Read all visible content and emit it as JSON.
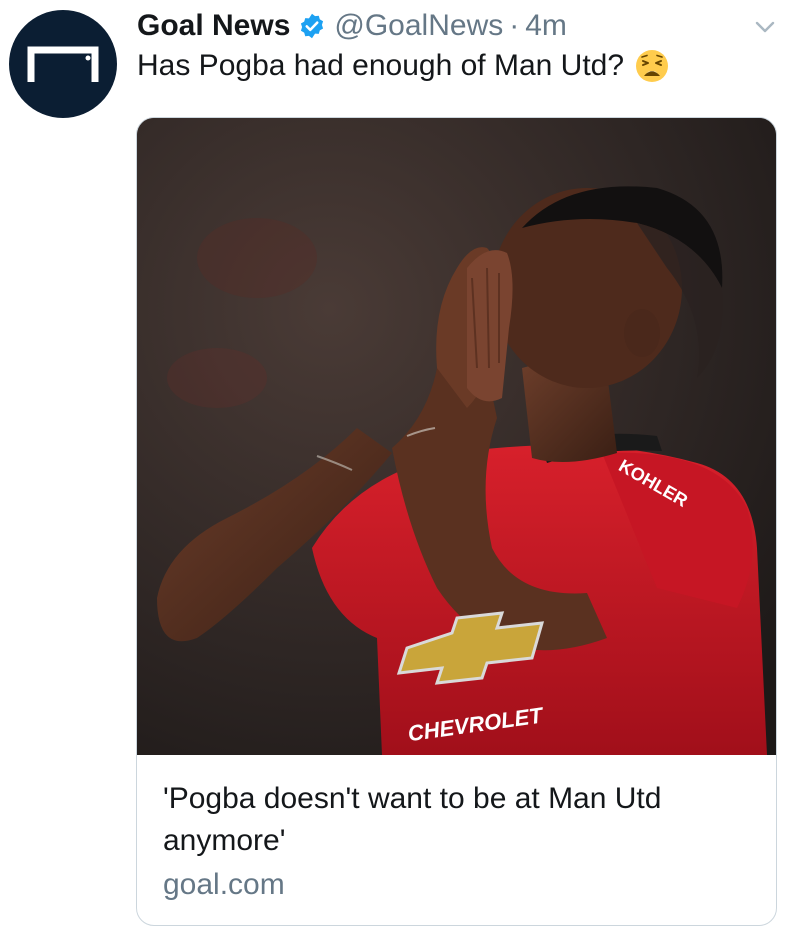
{
  "author": {
    "display_name": "Goal News",
    "handle": "@GoalNews",
    "separator": "·",
    "timestamp": "4m",
    "verified": true,
    "avatar_icon": "goal-logo-icon"
  },
  "tweet": {
    "text": "Has Pogba had enough of Man Utd?",
    "emoji_icon": "weary-face-emoji"
  },
  "card": {
    "title": "'Pogba doesn't want to be at Man Utd anymore'",
    "domain": "goal.com",
    "image_icon": "player-photo",
    "shirt_sponsor": "CHEVROLET",
    "sleeve_sponsor": "KOHLER"
  },
  "colors": {
    "text_primary": "#14171a",
    "text_secondary": "#657786",
    "verified_blue": "#1da1f2",
    "avatar_bg": "#0b1e33",
    "card_border": "#ccd6dd",
    "kit_red": "#c8102e"
  }
}
